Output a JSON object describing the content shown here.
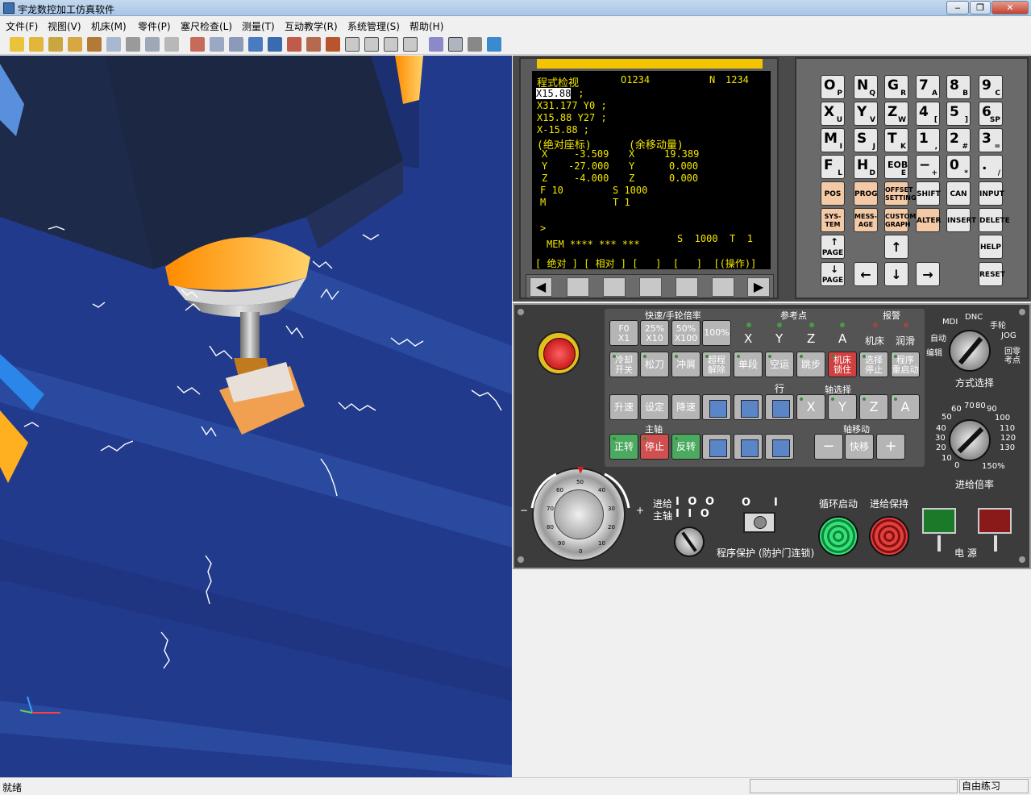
{
  "window": {
    "title": "宇龙数控加工仿真软件",
    "min": "‒",
    "max": "❐",
    "close": "✕"
  },
  "menu": [
    {
      "label": "文件(F)"
    },
    {
      "label": "视图(V)"
    },
    {
      "label": "机床(M)"
    },
    {
      "label": "零件(P)"
    },
    {
      "label": "塞尺检查(L)"
    },
    {
      "label": "测量(T)"
    },
    {
      "label": "互动教学(R)"
    },
    {
      "label": "系统管理(S)"
    },
    {
      "label": "帮助(H)"
    }
  ],
  "screen": {
    "mode": "程式检视",
    "prog": "O1234",
    "nlabel": "N",
    "nval": "1234",
    "cursor": "X15.88",
    "line1_rest": " ;",
    "line2": "X31.177 Y0 ;",
    "line3": "X15.88 Y27 ;",
    "line4": "X-15.88 ;",
    "abs_label": "(绝对座标)",
    "rem_label": "(余移动量)",
    "abs": [
      {
        "axis": "X",
        "value": "-3.509"
      },
      {
        "axis": "Y",
        "value": "-27.000"
      },
      {
        "axis": "Z",
        "value": "-4.000"
      }
    ],
    "rem": [
      {
        "axis": "X",
        "value": "19.389"
      },
      {
        "axis": "Y",
        "value": "0.000"
      },
      {
        "axis": "Z",
        "value": "0.000"
      }
    ],
    "f": "F 10",
    "s": "S 1000",
    "m": "M",
    "t": "T 1",
    "prompt": ">",
    "mem": "MEM **** *** ***",
    "s2": "S  1000  T  1",
    "softkeys": "[ 绝对 ] [ 相对 ] [   ]  [   ]  [(操作)]"
  },
  "keypad": [
    {
      "main": "O",
      "sub": "P"
    },
    {
      "main": "N",
      "sub": "Q"
    },
    {
      "main": "G",
      "sub": "R"
    },
    {
      "main": "7",
      "sub": "A"
    },
    {
      "main": "8",
      "sub": "B"
    },
    {
      "main": "9",
      "sub": "C"
    },
    {
      "main": "X",
      "sub": "U"
    },
    {
      "main": "Y",
      "sub": "V"
    },
    {
      "main": "Z",
      "sub": "W"
    },
    {
      "main": "4",
      "sub": "["
    },
    {
      "main": "5",
      "sub": "]"
    },
    {
      "main": "6",
      "sub": "SP"
    },
    {
      "main": "M",
      "sub": "I"
    },
    {
      "main": "S",
      "sub": "J"
    },
    {
      "main": "T",
      "sub": "K"
    },
    {
      "main": "1",
      "sub": ","
    },
    {
      "main": "2",
      "sub": "#"
    },
    {
      "main": "3",
      "sub": "="
    },
    {
      "main": "F",
      "sub": "L"
    },
    {
      "main": "H",
      "sub": "D"
    },
    {
      "main": "EOB",
      "sub": "E"
    },
    {
      "main": "−",
      "sub": "+"
    },
    {
      "main": "0",
      "sub": "*"
    },
    {
      "main": ".",
      "sub": "/"
    }
  ],
  "fnkeys": {
    "r5": [
      "POS",
      "PROG",
      "OFFSET SETTING",
      "SHIFT",
      "CAN",
      "INPUT"
    ],
    "r6": [
      "SYS-TEM",
      "MESS-AGE",
      "CUSTOM GRAPH",
      "ALTER",
      "INSERT",
      "DELETE"
    ],
    "pageup": "PAGE",
    "pagedown": "PAGE",
    "help": "HELP",
    "reset": "RESET",
    "up": "↑",
    "down": "↓",
    "left": "←",
    "right": "→"
  },
  "panel": {
    "rate_label": "快速/手轮倍率",
    "ref_label": "参考点",
    "alarm_label": "报警",
    "rate_btns": [
      {
        "l1": "F0",
        "l2": "X1"
      },
      {
        "l1": "25%",
        "l2": "X10"
      },
      {
        "l1": "50%",
        "l2": "X100"
      },
      {
        "l1": "100%",
        "l2": ""
      }
    ],
    "ref_axes": [
      "X",
      "Y",
      "Z",
      "A"
    ],
    "alarms": [
      "机床",
      "润滑"
    ],
    "row2": [
      {
        "l1": "冷却",
        "l2": "开关"
      },
      {
        "l1": "松刀",
        "l2": ""
      },
      {
        "l1": "冲屑",
        "l2": ""
      },
      {
        "l1": "超程",
        "l2": "解除"
      },
      {
        "l1": "单段",
        "l2": ""
      },
      {
        "l1": "空运行",
        "l2": ""
      },
      {
        "l1": "跳步",
        "l2": ""
      },
      {
        "l1": "机床",
        "l2": "锁住"
      },
      {
        "l1": "选择",
        "l2": "停止"
      },
      {
        "l1": "程序",
        "l2": "重启动"
      }
    ],
    "axis_select_label": "轴选择",
    "row3": [
      "升速",
      "设定",
      "降速"
    ],
    "axes": [
      "X",
      "Y",
      "Z",
      "A"
    ],
    "spindle_label": "主轴",
    "spindle": [
      "正转",
      "停止",
      "反转"
    ],
    "axis_move_label": "轴移动",
    "move": [
      "−",
      "快移",
      "+"
    ],
    "mode_label": "方式选择",
    "modes": [
      "MDI",
      "DNC",
      "手轮",
      "自动",
      "JOG",
      "编辑",
      "回零",
      "考点"
    ],
    "feed_label": "进给倍率",
    "feed_ticks": [
      "0",
      "10",
      "20",
      "30",
      "40",
      "50",
      "60",
      "70",
      "80",
      "90",
      "100",
      "110",
      "120",
      "130",
      "150%"
    ],
    "feed": "进给",
    "spindle2": "主轴",
    "bits1": "I O O",
    "bits2": "I I O",
    "hand_minus": "−",
    "hand_plus": "+",
    "hand_ticks": [
      "50",
      "40",
      "30",
      "20",
      "10",
      "0",
      "90",
      "80",
      "70",
      "60"
    ],
    "prot_0": "O",
    "prot_1": "I",
    "protect_label": "程序保护 (防护门连锁)",
    "cycle_start": "循环启动",
    "feed_hold": "进给保持",
    "power_label": "电  源"
  },
  "status": {
    "left": "就绪",
    "right": "自由练习"
  }
}
